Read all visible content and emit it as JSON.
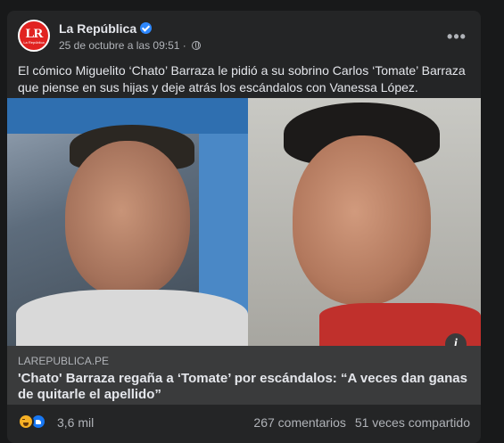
{
  "post": {
    "page_name": "La República",
    "avatar_text": "LR",
    "avatar_sub": "La República",
    "date": "25 de octubre a las 09:51",
    "separator": "·",
    "text": "El cómico Miguelito ‘Chato’ Barraza le pidió a su sobrino Carlos ‘Tomate’ Barraza que piense en sus hijas y deje atrás los escándalos con Vanessa López.",
    "more_label": "•••"
  },
  "link": {
    "domain": "LAREPUBLICA.PE",
    "title": "'Chato' Barraza regaña a ‘Tomate’ por escándalos: “A veces dan ganas de quitarle el apellido”",
    "info_label": "i"
  },
  "footer": {
    "reactions_count": "3,6 mil",
    "comments": "267 comentarios",
    "shares": "51 veces compartido"
  },
  "colors": {
    "background": "#18191a",
    "card": "#242526",
    "link_box": "#3a3b3c",
    "brand_red": "#e12321",
    "verified_blue": "#2d88ff"
  }
}
